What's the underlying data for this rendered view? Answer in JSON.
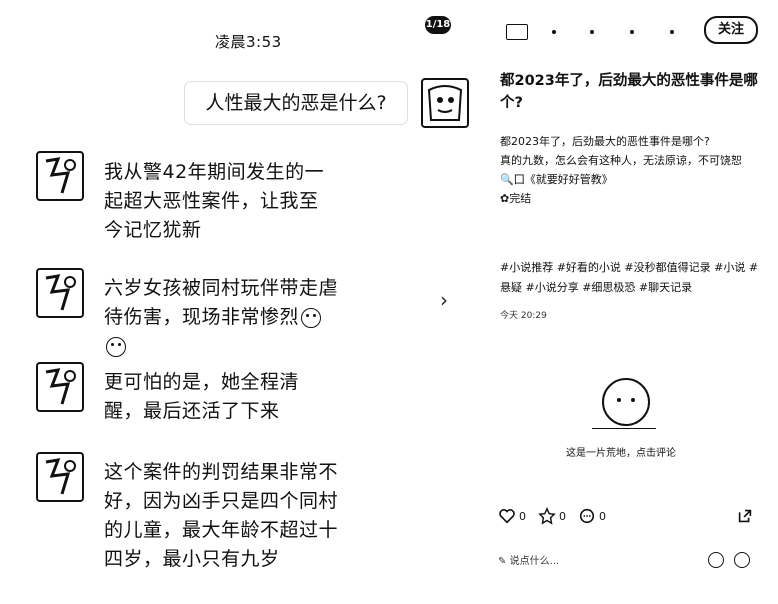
{
  "left": {
    "time": "凌晨3:53",
    "page_badge": "1/18",
    "question": "人性最大的恶是什么?",
    "messages": [
      {
        "text": "我从警42年期间发生的一起超大恶性案件，让我至今记忆犹新"
      },
      {
        "text": "六岁女孩被同村玩伴带走虐待伤害，现场非常惨烈"
      },
      {
        "text": "更可怕的是，她全程清醒，最后还活了下来"
      },
      {
        "text": "这个案件的判罚结果非常不好，因为凶手只是四个同村的儿童，最大年龄不超过十四岁，最小只有九岁"
      }
    ]
  },
  "right": {
    "follow_label": "关注",
    "title": "都2023年了，后劲最大的恶性事件是哪个?",
    "body_lines": [
      "都2023年了，后劲最大的恶性事件是哪个?",
      "真的九数，怎么会有这种人，无法原谅，不可饶恕",
      "🔍囗《就要好好管教》",
      "✿完结"
    ],
    "tags": "#小说推荐 #好看的小说 #没秒都值得记录 #小说 #悬疑 #小说分享 #细思极恐 #聊天记录",
    "post_time": "今天 20:29",
    "empty_text": "这是一片荒地，点击评论",
    "actions": {
      "like": "0",
      "star": "0",
      "comment": "0"
    },
    "comment_placeholder": "说点什么..."
  }
}
